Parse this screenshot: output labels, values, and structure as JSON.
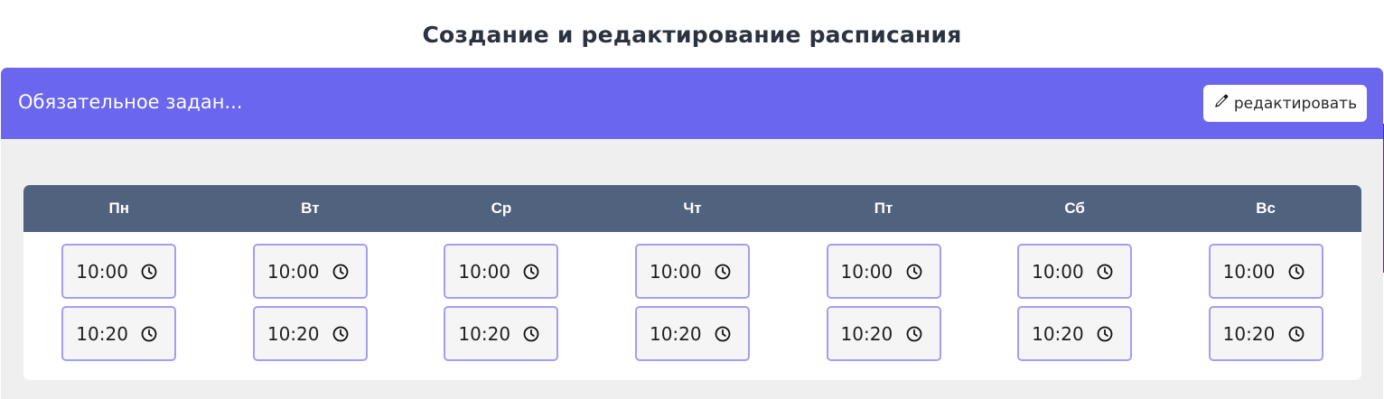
{
  "page": {
    "title": "Создание и редактирование расписания"
  },
  "task": {
    "name": "Обязательное задан...",
    "edit_label": "редактировать"
  },
  "icons": {
    "edit": "pencil-icon",
    "clock": "clock-icon"
  },
  "colors": {
    "header": "#6a66ee",
    "days_bar": "#51627f",
    "input_border": "#a49ef2",
    "accent_purple": "#7a1f6e",
    "accent_green": "#7ae04a"
  },
  "schedule": {
    "days": [
      {
        "label": "Пн",
        "times": [
          "10:00",
          "10:20"
        ]
      },
      {
        "label": "Вт",
        "times": [
          "10:00",
          "10:20"
        ]
      },
      {
        "label": "Ср",
        "times": [
          "10:00",
          "10:20"
        ]
      },
      {
        "label": "Чт",
        "times": [
          "10:00",
          "10:20"
        ]
      },
      {
        "label": "Пт",
        "times": [
          "10:00",
          "10:20"
        ]
      },
      {
        "label": "Сб",
        "times": [
          "10:00",
          "10:20"
        ]
      },
      {
        "label": "Вс",
        "times": [
          "10:00",
          "10:20"
        ]
      }
    ]
  }
}
